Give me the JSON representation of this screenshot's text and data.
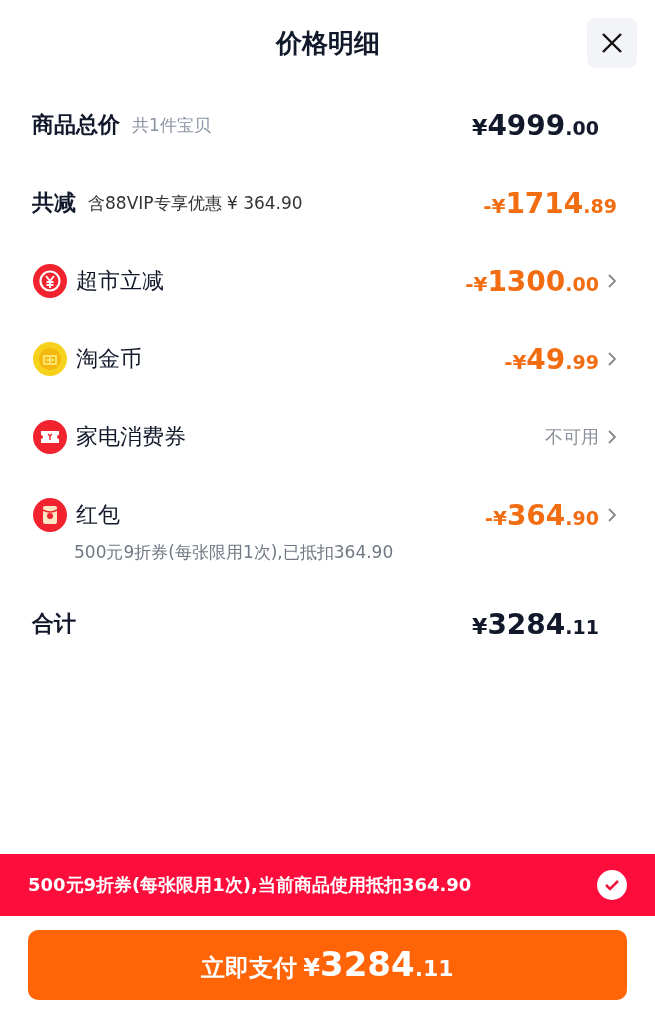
{
  "title": "价格明细",
  "rows": [
    {
      "kind": "subtotal",
      "label": "商品总价",
      "note": "共1件宝贝",
      "amount": "¥4999.00"
    },
    {
      "kind": "reduction",
      "label": "共减",
      "note": "含88VIP专享优惠 ¥ 364.90",
      "amount": "-¥1714.89"
    },
    {
      "kind": "benefit",
      "label": "超市立减",
      "amount": "-¥1300.00",
      "disabled": false
    },
    {
      "kind": "benefit",
      "label": "淘金币",
      "amount": "-¥49.99",
      "disabled": false
    },
    {
      "kind": "benefit",
      "label": "家电消费券",
      "amount": "不可用",
      "disabled": true
    },
    {
      "kind": "benefit",
      "label": "红包",
      "amount": "-¥364.90",
      "disabled": false,
      "detail": "500元9折券(每张限用1次),已抵扣364.90"
    },
    {
      "kind": "subtotal",
      "label": "合计",
      "amount": "¥3284.11"
    }
  ],
  "banner": {
    "text": "500元9折券(每张限用1次),当前商品使用抵扣364.90",
    "checked": true
  },
  "pay_button": {
    "label": "立即支付",
    "amount": "¥3284.11"
  }
}
